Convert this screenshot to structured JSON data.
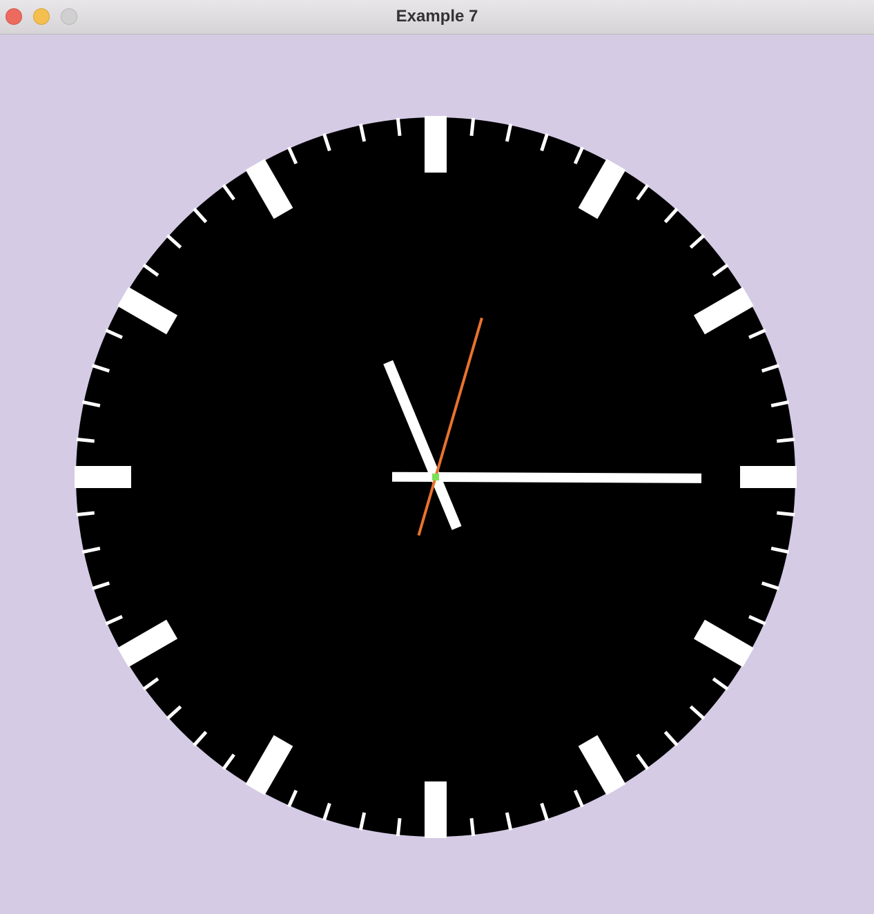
{
  "window": {
    "title": "Example 7"
  },
  "colors": {
    "background": "#d5cbe5",
    "face": "#000000",
    "ticks": "#ffffff",
    "hour_hand": "#ffffff",
    "minute_hand": "#ffffff",
    "second_hand": "#e8732f",
    "center_dot": "#7ee05a"
  },
  "clock": {
    "hour_ticks": 12,
    "minute_ticks": 60,
    "time_shown": {
      "hour": 11,
      "minute": 15,
      "second": 2.7
    }
  }
}
